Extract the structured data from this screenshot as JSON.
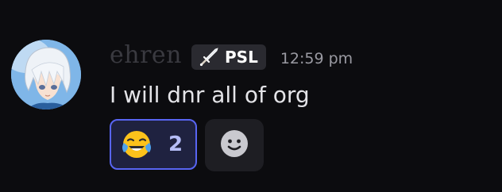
{
  "message": {
    "username": "ehren",
    "tag": {
      "icon": "sword-icon",
      "label": "PSL"
    },
    "timestamp": "12:59 pm",
    "content": "I will dnr all of org",
    "reactions": [
      {
        "emoji": "joy-emoji",
        "count": "2",
        "selected": true
      }
    ],
    "add_reaction_icon": "smiley-icon"
  },
  "colors": {
    "background": "#0c0c0f",
    "reaction_border": "#5865f2",
    "reaction_bg": "#1f2240",
    "reaction_count": "#b5bdf7",
    "tag_bg": "#2a2a30",
    "timestamp": "#9a9aa2",
    "content": "#e4e4e8"
  }
}
